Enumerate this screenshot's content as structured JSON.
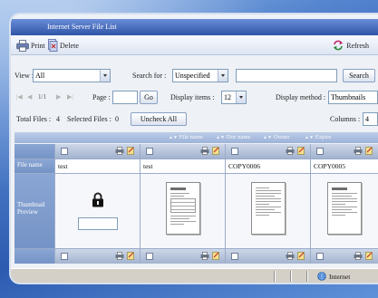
{
  "window": {
    "title": "Internet Server File List"
  },
  "toolbar": {
    "print": "Print",
    "delete": "Delete",
    "refresh": "Refresh"
  },
  "filters": {
    "view_label": "View :",
    "view_value": "All",
    "search_for_label": "Search for :",
    "search_for_value": "Unspecified",
    "search_text": "",
    "search_button": "Search"
  },
  "pager": {
    "page_indicator": "1/1",
    "page_label": "Page :",
    "page_input": "",
    "go_button": "Go",
    "display_items_label": "Display items :",
    "display_items_value": "12",
    "display_method_label": "Display method :",
    "display_method_value": "Thumbnails"
  },
  "summary": {
    "total_files_label": "Total Files :",
    "total_files": "4",
    "selected_files_label": "Selected Files :",
    "selected_files": "0",
    "uncheck_all_button": "Uncheck All",
    "columns_label": "Columns :",
    "columns_value": "4"
  },
  "sort_links": [
    "File name",
    "Doc name",
    "Owner",
    "Expire"
  ],
  "grid": {
    "row_labels": {
      "file_name": "File name",
      "thumbnail": "Thumbnail Preview"
    },
    "files": [
      {
        "name": "test",
        "locked": true,
        "checked": false,
        "password": ""
      },
      {
        "name": "test",
        "locked": false,
        "checked": false
      },
      {
        "name": "COPY0006",
        "locked": false,
        "checked": false
      },
      {
        "name": "COPY0005",
        "locked": false,
        "checked": false
      }
    ]
  },
  "status_bar": {
    "zone": "Internet"
  },
  "icons": {
    "print": "print-icon",
    "delete": "delete-icon",
    "refresh": "refresh-icon",
    "first_page": "first-page-icon",
    "prev_page": "prev-page-icon",
    "next_page": "next-page-icon",
    "last_page": "last-page-icon",
    "lock": "lock-icon",
    "file_print": "print-file-icon",
    "file_edit": "edit-file-icon",
    "zone": "globe-icon"
  },
  "colors": {
    "title_bar": "#2f55a6",
    "label_column": "#7e9ccd",
    "desktop": "#2c5bb0"
  }
}
